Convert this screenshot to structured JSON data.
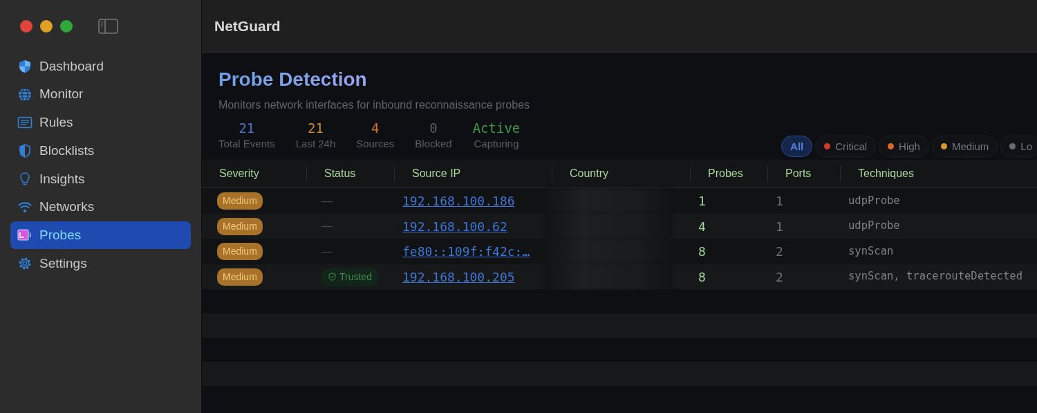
{
  "window": {
    "title": "NetGuard"
  },
  "sidebar": {
    "items": [
      {
        "label": "Dashboard",
        "selected": false
      },
      {
        "label": "Monitor",
        "selected": false
      },
      {
        "label": "Rules",
        "selected": false
      },
      {
        "label": "Blocklists",
        "selected": false
      },
      {
        "label": "Insights",
        "selected": false
      },
      {
        "label": "Networks",
        "selected": false
      },
      {
        "label": "Probes",
        "selected": true
      },
      {
        "label": "Settings",
        "selected": false
      }
    ]
  },
  "page": {
    "title": "Probe Detection",
    "subtitle": "Monitors network interfaces for inbound reconnaissance probes"
  },
  "stats": [
    {
      "value": "21",
      "label": "Total Events",
      "color": "#4a74c9"
    },
    {
      "value": "21",
      "label": "Last 24h",
      "color": "#c9892f"
    },
    {
      "value": "4",
      "label": "Sources",
      "color": "#d26f2a"
    },
    {
      "value": "0",
      "label": "Blocked",
      "color": "#5c5f66"
    },
    {
      "value": "Active",
      "label": "Capturing",
      "color": "#3f9a4a"
    }
  ],
  "filters": [
    {
      "label": "All",
      "selected": true
    },
    {
      "label": "Critical",
      "selected": false,
      "color": "#d2392f"
    },
    {
      "label": "High",
      "selected": false,
      "color": "#d9662a"
    },
    {
      "label": "Medium",
      "selected": false,
      "color": "#d9962a"
    },
    {
      "label": "Lo",
      "selected": false,
      "color": "#6b6d71"
    }
  ],
  "table": {
    "columns": [
      "Severity",
      "Status",
      "Source IP",
      "Country",
      "Probes",
      "Ports",
      "Techniques"
    ],
    "rows": [
      {
        "severity": "Medium",
        "status": {
          "kind": "none",
          "text": "—"
        },
        "source_ip": "192.168.100.186",
        "probes": "1",
        "ports": "1",
        "techniques": "udpProbe"
      },
      {
        "severity": "Medium",
        "status": {
          "kind": "none",
          "text": "—"
        },
        "source_ip": "192.168.100.62",
        "probes": "4",
        "ports": "1",
        "techniques": "udpProbe"
      },
      {
        "severity": "Medium",
        "status": {
          "kind": "none",
          "text": "—"
        },
        "source_ip": "fe80::109f:f42c:…",
        "probes": "8",
        "ports": "2",
        "techniques": "synScan"
      },
      {
        "severity": "Medium",
        "status": {
          "kind": "trusted",
          "text": "Trusted"
        },
        "source_ip": "192.168.100.205",
        "probes": "8",
        "ports": "2",
        "techniques": "synScan, tracerouteDetected"
      }
    ]
  }
}
